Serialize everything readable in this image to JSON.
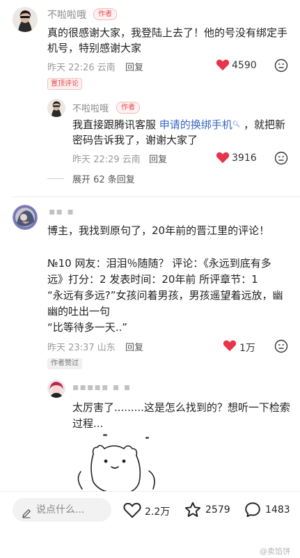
{
  "comment1": {
    "username": "不啦啦哦",
    "author_tag": "作者",
    "text_line1": "真的很感谢大家，我登陆上去了！他的号没有绑定手",
    "text_line2": "机号，特别感谢大家",
    "date": "昨天 22:26 云南",
    "reply_label": "回复",
    "likes": "4590",
    "pinned_label": "置顶评论",
    "reply": {
      "username": "不啦啦哦",
      "author_tag": "作者",
      "text_prefix": "我直接跟腾讯客服 ",
      "link_text": "申请的换绑手机",
      "text_suffix": " ，就把新",
      "text_line2": "密码告诉我了，谢谢大家了",
      "date": "昨天 22:29 云南",
      "reply_label": "回复",
      "likes": "3916"
    },
    "expand_label": "展开 62 条回复"
  },
  "comment2": {
    "username": "▪▪ ▪",
    "text_line1": "博主，我找到原句了，20年前的晋江里的评论！",
    "text_line2": "№10 网友：泪泪％随随？ 评论：《永远到底有多",
    "text_line3": "远》打分：2 发表时间：20年前 所评章节：1",
    "text_line4": "“永远有多远?”女孩问着男孩，男孩遥望着远放，幽",
    "text_line5": "幽的吐出一句",
    "text_line6": "“比等待多一天..”",
    "date": "昨天 23:37 山东",
    "reply_label": "回复",
    "likes": "1万",
    "author_liked_label": "作者赞过",
    "reply": {
      "username": "▪▪▪▪▪  ▪  ▪",
      "text_line1": "太厉害了.........这是怎么找到的？想听一下检索",
      "text_line2": "过程..."
    }
  },
  "bottom_bar": {
    "input_placeholder": "说点什么...",
    "like_count": "2.2万",
    "star_count": "2579",
    "comment_count": "1483"
  },
  "watermark": "@卖馅饼",
  "colors": {
    "like_red": "#e8344a",
    "accent_red": "#e8484e",
    "link_blue": "#3b66c4"
  }
}
